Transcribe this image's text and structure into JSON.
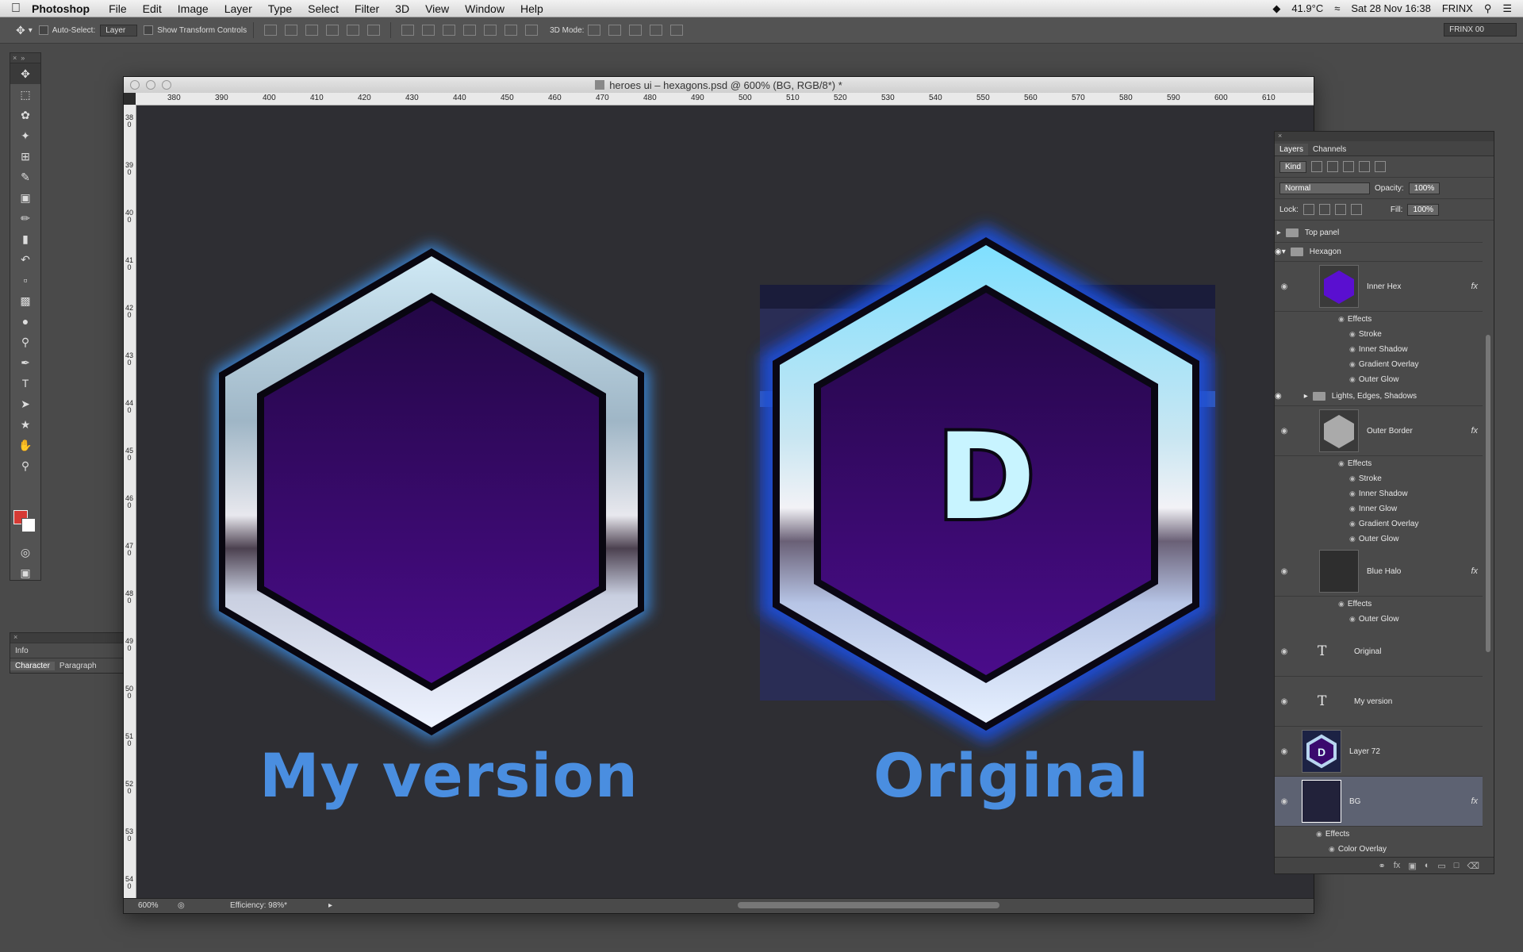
{
  "menubar": {
    "app": "Photoshop",
    "items": [
      "File",
      "Edit",
      "Image",
      "Layer",
      "Type",
      "Select",
      "Filter",
      "3D",
      "View",
      "Window",
      "Help"
    ],
    "status": {
      "temp": "41.9°C",
      "datetime": "Sat 28 Nov  16:38",
      "user": "FRINX"
    }
  },
  "options": {
    "auto_select": "Auto-Select:",
    "auto_select_value": "Layer",
    "show_transform": "Show Transform Controls",
    "mode_3d": "3D Mode:",
    "workspace": "FRINX 00"
  },
  "document": {
    "title": "heroes ui – hexagons.psd @ 600% (BG, RGB/8*) *",
    "zoom": "600%",
    "efficiency": "Efficiency: 98%*",
    "ruler_h": [
      "380",
      "390",
      "400",
      "410",
      "420",
      "430",
      "440",
      "450",
      "460",
      "470",
      "480",
      "490",
      "500",
      "510",
      "520",
      "530",
      "540",
      "550",
      "560",
      "570",
      "580",
      "590",
      "600",
      "610"
    ],
    "ruler_v": [
      "380",
      "390",
      "400",
      "410",
      "420",
      "430",
      "440",
      "450",
      "460",
      "470",
      "480",
      "490",
      "500",
      "510",
      "520",
      "530",
      "540"
    ],
    "labels": {
      "mine": "My version",
      "original": "Original"
    },
    "letter": "D"
  },
  "panels": {
    "info": "Info",
    "character": "Character",
    "paragraph": "Paragraph"
  },
  "layers_panel": {
    "tabs": [
      "Layers",
      "Channels"
    ],
    "kind": "Kind",
    "blend": "Normal",
    "opacity_label": "Opacity:",
    "opacity": "100%",
    "lock_label": "Lock:",
    "fill_label": "Fill:",
    "fill": "100%",
    "groups": {
      "top": "Top panel",
      "hexagon": "Hexagon",
      "lights": "Lights, Edges, Shadows"
    },
    "inner_hex": {
      "name": "Inner Hex",
      "effects": [
        "Effects",
        "Stroke",
        "Inner Shadow",
        "Gradient Overlay",
        "Outer Glow"
      ]
    },
    "outer_border": {
      "name": "Outer Border",
      "effects": [
        "Effects",
        "Stroke",
        "Inner Shadow",
        "Inner Glow",
        "Gradient Overlay",
        "Outer Glow"
      ]
    },
    "blue_halo": {
      "name": "Blue Halo",
      "effects": [
        "Effects",
        "Outer Glow"
      ]
    },
    "text_layers": [
      "Original",
      "My version"
    ],
    "layer72": "Layer 72",
    "bg": {
      "name": "BG",
      "effects": [
        "Effects",
        "Color Overlay"
      ]
    },
    "fx": "fx"
  },
  "colors": {
    "accent_text": "#4a8ee0",
    "hex_fill": "#3a0a6e",
    "glow": "#3a8ee8",
    "fg_swatch": "#d63a34"
  }
}
